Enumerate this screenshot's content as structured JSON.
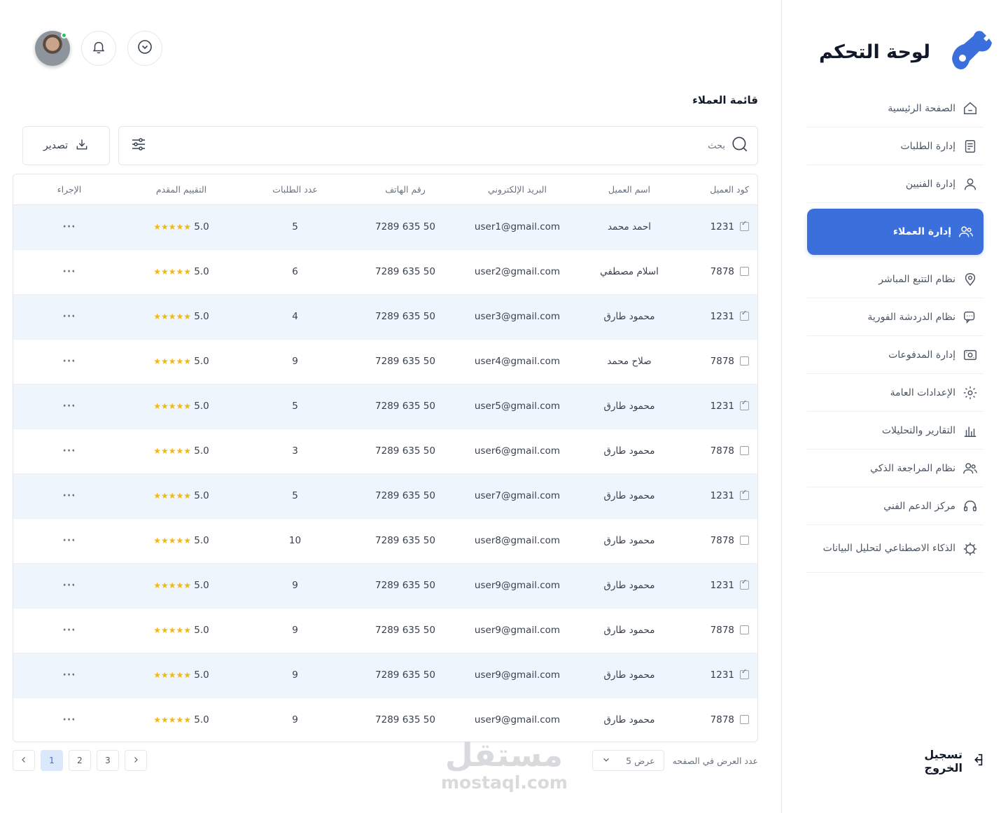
{
  "sidebar": {
    "title": "لوحة التحكم",
    "items": [
      {
        "label": "الصفحة الرئيسية",
        "icon": "home-icon"
      },
      {
        "label": "إدارة الطلبات",
        "icon": "receipt-icon"
      },
      {
        "label": "إدارة الفنيين",
        "icon": "user-icon"
      },
      {
        "label": "إدارة العملاء",
        "icon": "users-icon"
      },
      {
        "label": "نظام التتبع المباشر",
        "icon": "location-pin-icon"
      },
      {
        "label": "نظام الدردشة الفورية",
        "icon": "chat-icon"
      },
      {
        "label": "إدارة المدفوعات",
        "icon": "money-icon"
      },
      {
        "label": "الإعدادات العامة",
        "icon": "gear-icon"
      },
      {
        "label": "التقارير والتحليلات",
        "icon": "bar-chart-icon"
      },
      {
        "label": "نظام المراجعة الذكي",
        "icon": "users-review-icon"
      },
      {
        "label": "مركز الدعم الفني",
        "icon": "headset-icon"
      },
      {
        "label": "الذكاء الاصطناعي لتحليل البيانات",
        "icon": "ai-gear-icon"
      }
    ],
    "active_index": 3,
    "logout": "تسجيل الخروج"
  },
  "header": {
    "page_title": "قائمة العملاء"
  },
  "toolbar": {
    "search_placeholder": "بحث",
    "export_label": "تصدير"
  },
  "table": {
    "columns": {
      "code": "كود العميل",
      "name": "اسم العميل",
      "email": "البريد الإلكتروني",
      "phone": "رقم الهاتف",
      "orders": "عدد الطلبات",
      "rating": "التقييم المقدم",
      "action": "الإجراء"
    },
    "rows": [
      {
        "checked": true,
        "code": "1231",
        "name": "احمد محمد",
        "email": "user1@gmail.com",
        "phone": "50 635 7289",
        "orders": "5",
        "rating": "5.0",
        "stars": "★★★★★",
        "action": "···"
      },
      {
        "checked": false,
        "code": "7878",
        "name": "اسلام مصطفي",
        "email": "user2@gmail.com",
        "phone": "50 635 7289",
        "orders": "6",
        "rating": "5.0",
        "stars": "★★★★★",
        "action": "···"
      },
      {
        "checked": true,
        "code": "1231",
        "name": "محمود طارق",
        "email": "user3@gmail.com",
        "phone": "50 635 7289",
        "orders": "4",
        "rating": "5.0",
        "stars": "★★★★★",
        "action": "···"
      },
      {
        "checked": false,
        "code": "7878",
        "name": "صلاح محمد",
        "email": "user4@gmail.com",
        "phone": "50 635 7289",
        "orders": "9",
        "rating": "5.0",
        "stars": "★★★★★",
        "action": "···"
      },
      {
        "checked": true,
        "code": "1231",
        "name": "محمود طارق",
        "email": "user5@gmail.com",
        "phone": "50 635 7289",
        "orders": "5",
        "rating": "5.0",
        "stars": "★★★★★",
        "action": "···"
      },
      {
        "checked": false,
        "code": "7878",
        "name": "محمود طارق",
        "email": "user6@gmail.com",
        "phone": "50 635 7289",
        "orders": "3",
        "rating": "5.0",
        "stars": "★★★★★",
        "action": "···"
      },
      {
        "checked": true,
        "code": "1231",
        "name": "محمود طارق",
        "email": "user7@gmail.com",
        "phone": "50 635 7289",
        "orders": "5",
        "rating": "5.0",
        "stars": "★★★★★",
        "action": "···"
      },
      {
        "checked": false,
        "code": "7878",
        "name": "محمود طارق",
        "email": "user8@gmail.com",
        "phone": "50 635 7289",
        "orders": "10",
        "rating": "5.0",
        "stars": "★★★★★",
        "action": "···"
      },
      {
        "checked": true,
        "code": "1231",
        "name": "محمود طارق",
        "email": "user9@gmail.com",
        "phone": "50 635 7289",
        "orders": "9",
        "rating": "5.0",
        "stars": "★★★★★",
        "action": "···"
      },
      {
        "checked": false,
        "code": "7878",
        "name": "محمود طارق",
        "email": "user9@gmail.com",
        "phone": "50 635 7289",
        "orders": "9",
        "rating": "5.0",
        "stars": "★★★★★",
        "action": "···"
      },
      {
        "checked": true,
        "code": "1231",
        "name": "محمود طارق",
        "email": "user9@gmail.com",
        "phone": "50 635 7289",
        "orders": "9",
        "rating": "5.0",
        "stars": "★★★★★",
        "action": "···"
      },
      {
        "checked": false,
        "code": "7878",
        "name": "محمود طارق",
        "email": "user9@gmail.com",
        "phone": "50 635 7289",
        "orders": "9",
        "rating": "5.0",
        "stars": "★★★★★",
        "action": "···"
      }
    ]
  },
  "pagination": {
    "pages": [
      "1",
      "2",
      "3"
    ],
    "current": "1",
    "per_page_label": "عدد العرض في الصفحه",
    "per_page_value": "عرض 5"
  },
  "watermark": {
    "arabic": "مستقل",
    "latin": "mostaql.com"
  },
  "colors": {
    "accent": "#3a6fdc",
    "row_alt": "#eff5fd",
    "star": "#f5b80a",
    "online": "#22c55e"
  }
}
